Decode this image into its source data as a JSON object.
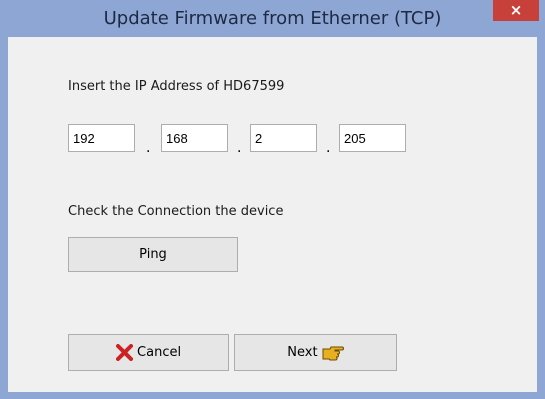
{
  "window": {
    "title": "Update Firmware from Etherner (TCP)",
    "close_label": "×"
  },
  "ip_section": {
    "label": "Insert the IP Address of HD67599",
    "octets": [
      "192",
      "168",
      "2",
      "205"
    ],
    "separator": "."
  },
  "connection_section": {
    "label": "Check the Connection the device",
    "ping_label": "Ping"
  },
  "footer": {
    "cancel_label": "Cancel",
    "next_label": "Next",
    "cancel_icon": "red-x-icon",
    "next_icon": "pointing-hand-icon"
  },
  "colors": {
    "title_bar": "#8ea6d3",
    "close_button": "#c7403a",
    "client_bg": "#f0f0f0",
    "cancel_icon": "#cc2222",
    "next_icon": "#e8b020"
  }
}
